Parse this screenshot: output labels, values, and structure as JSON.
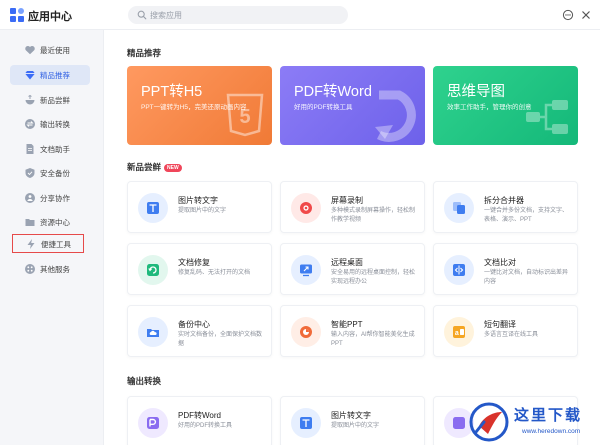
{
  "app": {
    "title": "应用中心"
  },
  "search": {
    "placeholder": "搜索应用"
  },
  "sidebar": {
    "items": [
      {
        "label": "最近使用",
        "icon": "heart-icon"
      },
      {
        "label": "精品推荐",
        "icon": "diamond-icon",
        "active": true
      },
      {
        "label": "新品尝鲜",
        "icon": "bowl-icon"
      },
      {
        "label": "输出转换",
        "icon": "convert-icon"
      },
      {
        "label": "文档助手",
        "icon": "document-icon"
      },
      {
        "label": "安全备份",
        "icon": "shield-icon"
      },
      {
        "label": "分享协作",
        "icon": "share-icon"
      },
      {
        "label": "资源中心",
        "icon": "folder-icon"
      },
      {
        "label": "便捷工具",
        "icon": "lightning-icon",
        "highlighted": true
      },
      {
        "label": "其他服务",
        "icon": "grid-icon"
      }
    ]
  },
  "sections": {
    "featured": {
      "title": "精品推荐"
    },
    "new": {
      "title": "新品尝鲜",
      "badge": "NEW"
    },
    "output": {
      "title": "输出转换"
    }
  },
  "banners": [
    {
      "title": "PPT转H5",
      "subtitle": "PPT一键转为H5，完美还原动画内容"
    },
    {
      "title": "PDF转Word",
      "subtitle": "好用的PDF转换工具"
    },
    {
      "title": "思维导图",
      "subtitle": "效率工作助手，管理你的创意"
    }
  ],
  "new_cards": [
    {
      "name": "图片转文字",
      "desc": "提取图片中的文字",
      "icon": "image-to-text-icon",
      "color": "#3f7df0"
    },
    {
      "name": "屏幕录制",
      "desc": "多种模式录制屏幕操作，轻松制作教学视频",
      "icon": "record-icon",
      "color": "#f04a4a"
    },
    {
      "name": "拆分合并器",
      "desc": "一键合并多份文档，支持文字、表格、演示、PPT",
      "icon": "split-merge-icon",
      "color": "#3f7df0"
    },
    {
      "name": "文档修复",
      "desc": "修复乱码、无法打开的文档",
      "icon": "repair-icon",
      "color": "#1fb97c"
    },
    {
      "name": "远程桌面",
      "desc": "安全易用的远程桌面控制，轻松实现远程办公",
      "icon": "remote-desktop-icon",
      "color": "#3f7df0"
    },
    {
      "name": "文档比对",
      "desc": "一键比对文档，自动标识出差异内容",
      "icon": "compare-icon",
      "color": "#3f7df0"
    },
    {
      "name": "备份中心",
      "desc": "实时文档备份，全面保护文档数据",
      "icon": "cloud-icon",
      "color": "#3f7df0"
    },
    {
      "name": "智能PPT",
      "desc": "输入内容，AI帮你智能美化生成PPT",
      "icon": "smart-ppt-icon",
      "color": "#f06b3a"
    },
    {
      "name": "短句翻译",
      "desc": "多语言互译在线工具",
      "icon": "translate-icon",
      "color": "#f5a623"
    }
  ],
  "output_cards": [
    {
      "name": "PDF转Word",
      "desc": "好用的PDF转换工具",
      "icon": "pdf-word-icon",
      "color": "#8a6cf0"
    },
    {
      "name": "图片转文字",
      "desc": "提取图片中的文字",
      "icon": "image-to-text-icon",
      "color": "#3f7df0"
    },
    {
      "name": "",
      "desc": "",
      "icon": "app-icon",
      "color": "#8a6cf0"
    }
  ],
  "watermark": {
    "text": "这里下载",
    "url": "www.heredown.com"
  }
}
